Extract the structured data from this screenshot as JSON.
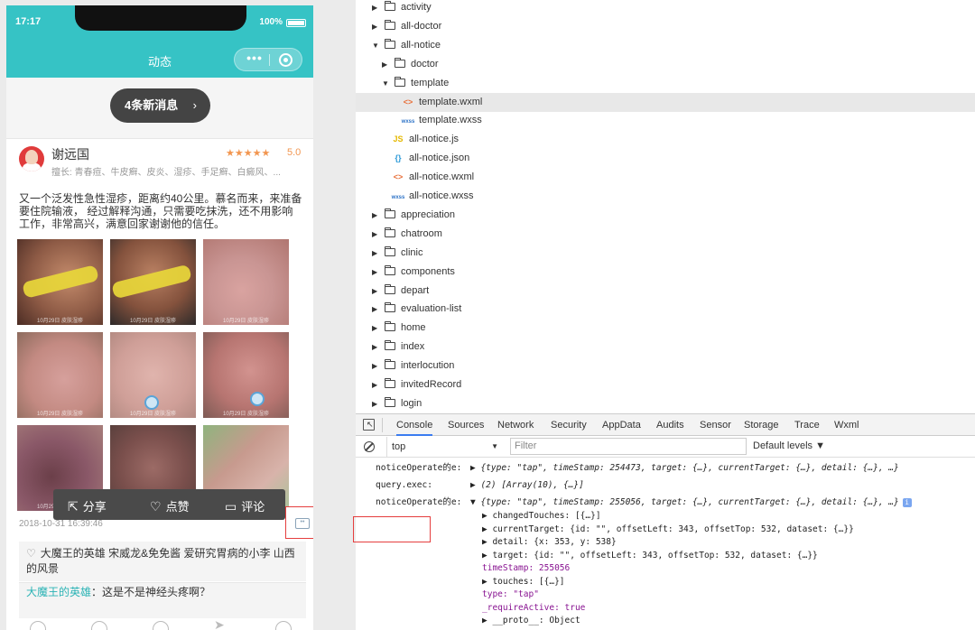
{
  "phone": {
    "time": "17:17",
    "battery": "100%",
    "nav_title": "动态",
    "capsule_dots": "•••",
    "new_messages": "4条新消息",
    "new_messages_arrow": "›",
    "post": {
      "doctor_name": "谢远国",
      "stars": "★★★★★",
      "rating": "5.0",
      "specialty": "擅长: 青春痘、牛皮癣、皮炎、湿疹、手足癣、白癜风、...",
      "text": "又一个泛发性急性湿疹，距离约40公里。慕名而来，来准备要住院输液， 经过解释沟通，只需要吃抹洗，还不用影响工作，非常高兴，满意回家谢谢他的信任。",
      "photo_watermark": "10月29日 皮肤湿疹",
      "share": "分享",
      "like": "点赞",
      "comment": "评论",
      "timestamp": "2018-10-31 16:39:46",
      "likes": "大魔王的英雄  宋威龙&免免酱  爱研究胃病的小李  山西的风景",
      "comment1_author": "大魔王的英雄",
      "comment1_text": "这是不是神经头疼啊？"
    }
  },
  "tree": [
    {
      "label": "activity",
      "type": "folder",
      "open": false,
      "indent": 0
    },
    {
      "label": "all-doctor",
      "type": "folder",
      "open": false,
      "indent": 0
    },
    {
      "label": "all-notice",
      "type": "folder",
      "open": true,
      "indent": 0
    },
    {
      "label": "doctor",
      "type": "folder",
      "open": false,
      "indent": 1
    },
    {
      "label": "template",
      "type": "folder",
      "open": true,
      "indent": 1
    },
    {
      "label": "template.wxml",
      "type": "wxml",
      "indent": 2,
      "selected": true
    },
    {
      "label": "template.wxss",
      "type": "wxss",
      "indent": 2
    },
    {
      "label": "all-notice.js",
      "type": "js",
      "indent": 1
    },
    {
      "label": "all-notice.json",
      "type": "json",
      "indent": 1
    },
    {
      "label": "all-notice.wxml",
      "type": "wxml",
      "indent": 1
    },
    {
      "label": "all-notice.wxss",
      "type": "wxss",
      "indent": 1
    },
    {
      "label": "appreciation",
      "type": "folder",
      "open": false,
      "indent": 0
    },
    {
      "label": "chatroom",
      "type": "folder",
      "open": false,
      "indent": 0
    },
    {
      "label": "clinic",
      "type": "folder",
      "open": false,
      "indent": 0
    },
    {
      "label": "components",
      "type": "folder",
      "open": false,
      "indent": 0
    },
    {
      "label": "depart",
      "type": "folder",
      "open": false,
      "indent": 0
    },
    {
      "label": "evaluation-list",
      "type": "folder",
      "open": false,
      "indent": 0
    },
    {
      "label": "home",
      "type": "folder",
      "open": false,
      "indent": 0
    },
    {
      "label": "index",
      "type": "folder",
      "open": false,
      "indent": 0
    },
    {
      "label": "interlocution",
      "type": "folder",
      "open": false,
      "indent": 0
    },
    {
      "label": "invitedRecord",
      "type": "folder",
      "open": false,
      "indent": 0
    },
    {
      "label": "login",
      "type": "folder",
      "open": false,
      "indent": 0
    }
  ],
  "icons": {
    "wxml": "<>",
    "wxss": "wxss",
    "js": "JS",
    "json": "{}"
  },
  "console": {
    "tabs": [
      "Console",
      "Sources",
      "Network",
      "Security",
      "AppData",
      "Audits",
      "Sensor",
      "Storage",
      "Trace",
      "Wxml"
    ],
    "context": "top",
    "filter_placeholder": "Filter",
    "levels": "Default levels ▼",
    "log1_label": "noticeOperate的e:",
    "log1_obj": "▶ {type: \"tap\", timeStamp: 254473, target: {…}, currentTarget: {…}, detail: {…}, …}",
    "log2_label": "query.exec:",
    "log2_obj": "▶ (2) [Array(10), {…}]",
    "log3_label": "noticeOperate的e:",
    "log3_obj": "▼ {type: \"tap\", timeStamp: 255056, target: {…}, currentTarget: {…}, detail: {…}, …}",
    "rows": [
      "▶ changedTouches: [{…}]",
      "▶ currentTarget: {id: \"\", offsetLeft: 343, offsetTop: 532, dataset: {…}}",
      "▶ detail: {x: 353, y: 538}",
      "▶ target: {id: \"\", offsetLeft: 343, offsetTop: 532, dataset: {…}}",
      "timeStamp: 255056",
      "▶ touches: [{…}]",
      "type: \"tap\"",
      "_requireActive: true",
      "▶ __proto__: Object"
    ]
  }
}
